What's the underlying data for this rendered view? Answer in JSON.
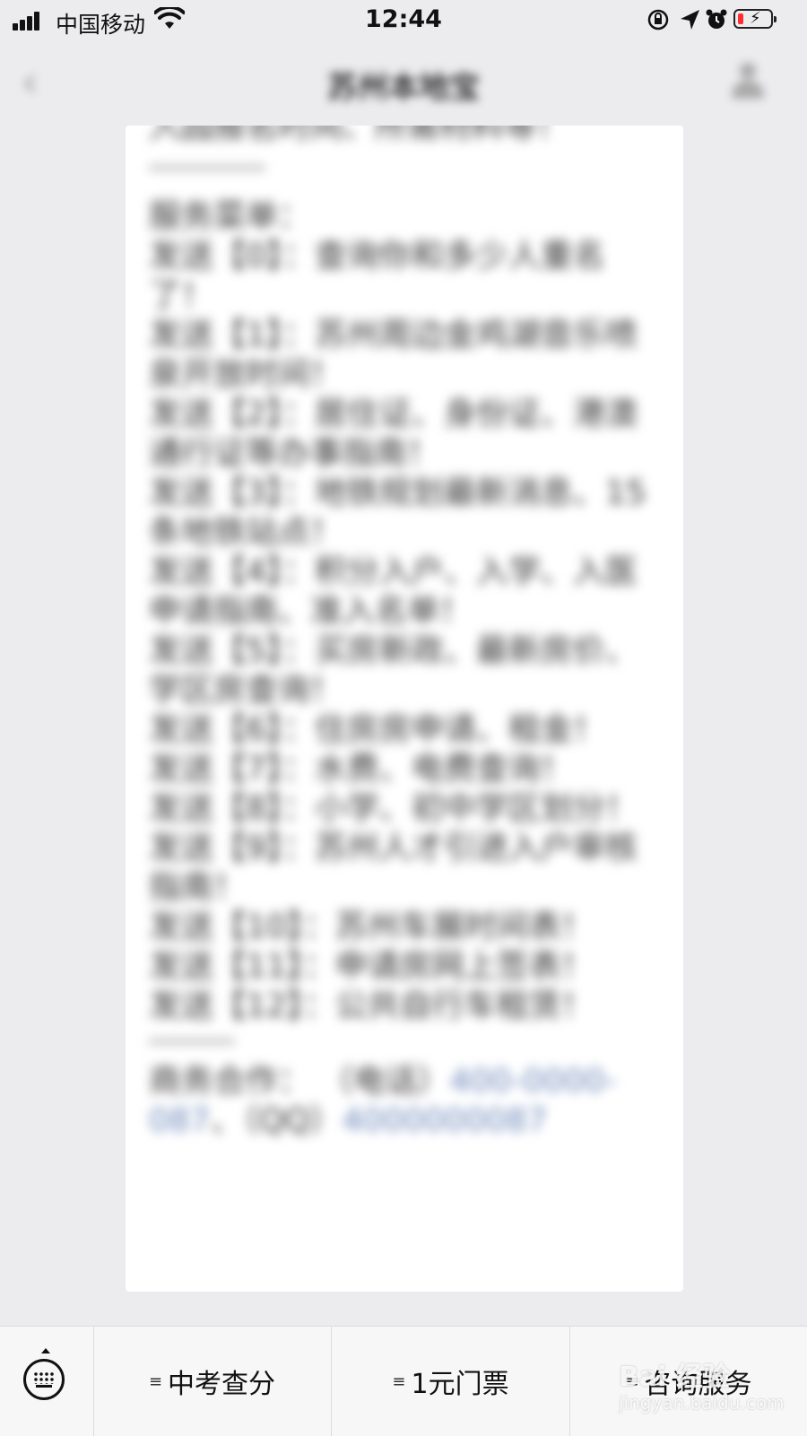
{
  "status_bar": {
    "carrier": "中国移动",
    "time": "12:44",
    "battery_level": 0.1,
    "icons": [
      "signal-icon",
      "wifi-icon",
      "rotation-lock-icon",
      "location-icon",
      "alarm-icon",
      "battery-charging-icon"
    ]
  },
  "nav": {
    "title": "苏州本地宝",
    "back_icon": "chevron-left-icon",
    "profile_icon": "person-icon"
  },
  "message": {
    "lines": [
      "入园报名时间、所需材料等！",
      "服务菜单：",
      "发送【0】：查询你和多少人重名了！",
      "发送【1】：苏州周边金鸡湖音乐喷泉开放时间！",
      "发送【2】：居住证、身份证、港澳通行证等办事指南！",
      "发送【3】：地铁规划最新消息、15条地铁站点！",
      "发送【4】：积分入户、入学、入医申请指南、准入名单！",
      "发送【5】：买房新政、最新房价、学区房查询！",
      "发送【6】：住房房申请、租金！",
      "发送【7】：水费、电费查询！",
      "发送【8】：小学、初中学区划分！",
      "发送【9】：苏州人才引进入户审核指南！",
      "发送【10】：苏州车展时间表！",
      "发送【11】：申请房网上签表！",
      "发送【12】：公共自行车租赁！"
    ],
    "contact_prefix": "商务合作： （电话）",
    "phone": "400-0000-087",
    "qq_prefix": "、（QQ）",
    "qq": "4000000087"
  },
  "bottom_menu": {
    "keyboard_icon": "keyboard-icon",
    "items": [
      {
        "label": "中考查分",
        "icon": "≡"
      },
      {
        "label": "1元门票",
        "icon": "≡"
      },
      {
        "label": "咨询服务",
        "icon": "≡"
      }
    ]
  },
  "watermark": {
    "logo": "Bai 经验",
    "url": "jingyan.baidu.com"
  }
}
